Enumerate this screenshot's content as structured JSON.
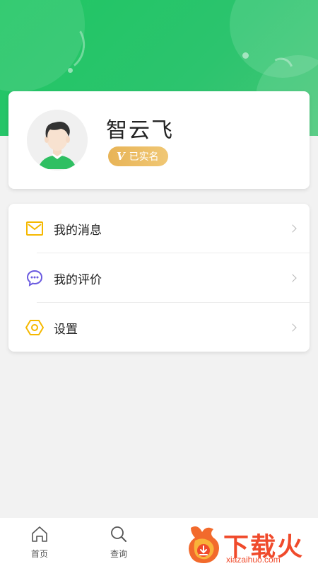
{
  "profile": {
    "name": "智云飞",
    "verify_label": "已实名",
    "verify_mark": "V"
  },
  "menu": {
    "items": [
      {
        "label": "我的消息",
        "icon": "mail-icon",
        "color": "#f5b800"
      },
      {
        "label": "我的评价",
        "icon": "comment-icon",
        "color": "#6a5ae0"
      },
      {
        "label": "设置",
        "icon": "settings-icon",
        "color": "#f5b800"
      }
    ]
  },
  "bottom_nav": {
    "items": [
      {
        "label": "首页",
        "icon": "home-icon"
      },
      {
        "label": "查询",
        "icon": "search-icon"
      }
    ]
  },
  "watermark": {
    "title": "下载火",
    "sub": "xiazaihuo.com"
  },
  "colors": {
    "brand_green": "#1fc663",
    "badge_gold": "#e8b457",
    "watermark_red": "#f04a2b"
  }
}
